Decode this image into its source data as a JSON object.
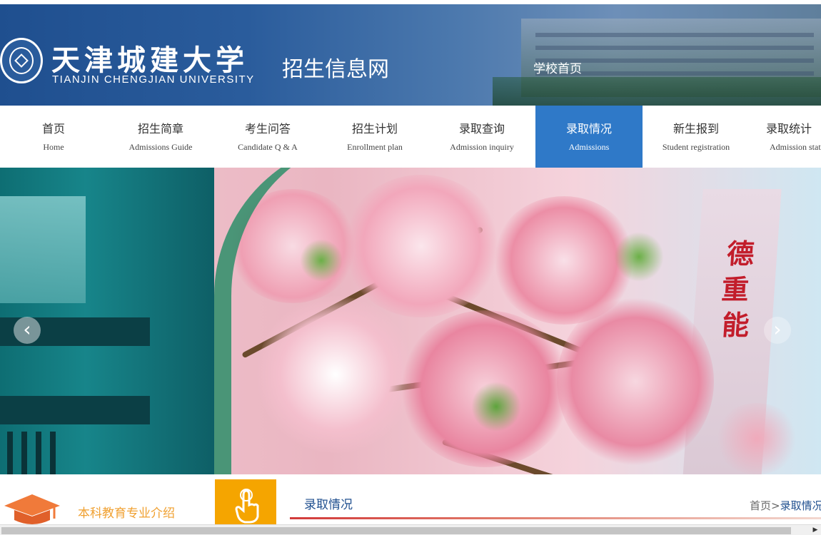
{
  "header": {
    "logo_cn": "天津城建大学",
    "logo_en": "TIANJIN CHENGJIAN UNIVERSITY",
    "site_title": "招生信息网",
    "home_link": "学校首页"
  },
  "nav": {
    "items": [
      {
        "cn": "首页",
        "en": "Home"
      },
      {
        "cn": "招生简章",
        "en": "Admissions Guide"
      },
      {
        "cn": "考生问答",
        "en": "Candidate Q & A"
      },
      {
        "cn": "招生计划",
        "en": "Enrollment plan"
      },
      {
        "cn": "录取查询",
        "en": "Admission inquiry"
      },
      {
        "cn": "录取情况",
        "en": "Admissions"
      },
      {
        "cn": "新生报到",
        "en": "Student registration"
      },
      {
        "cn": "录取统计",
        "en": "Admission statist"
      }
    ],
    "active_index": 5
  },
  "banner": {
    "sign_chars": [
      "德",
      "重",
      "能"
    ],
    "prev_icon": "‹",
    "next_icon": "›"
  },
  "sidebar": {
    "intro_label": "本科教育专业介绍"
  },
  "section": {
    "title": "录取情况",
    "breadcrumb_home": "首页",
    "breadcrumb_sep": ">",
    "breadcrumb_current": "录取情况"
  },
  "colors": {
    "header_blue": "#2a5c9c",
    "nav_active": "#2f79c8",
    "orange": "#f5a500",
    "accent_red": "#d23a3a"
  }
}
